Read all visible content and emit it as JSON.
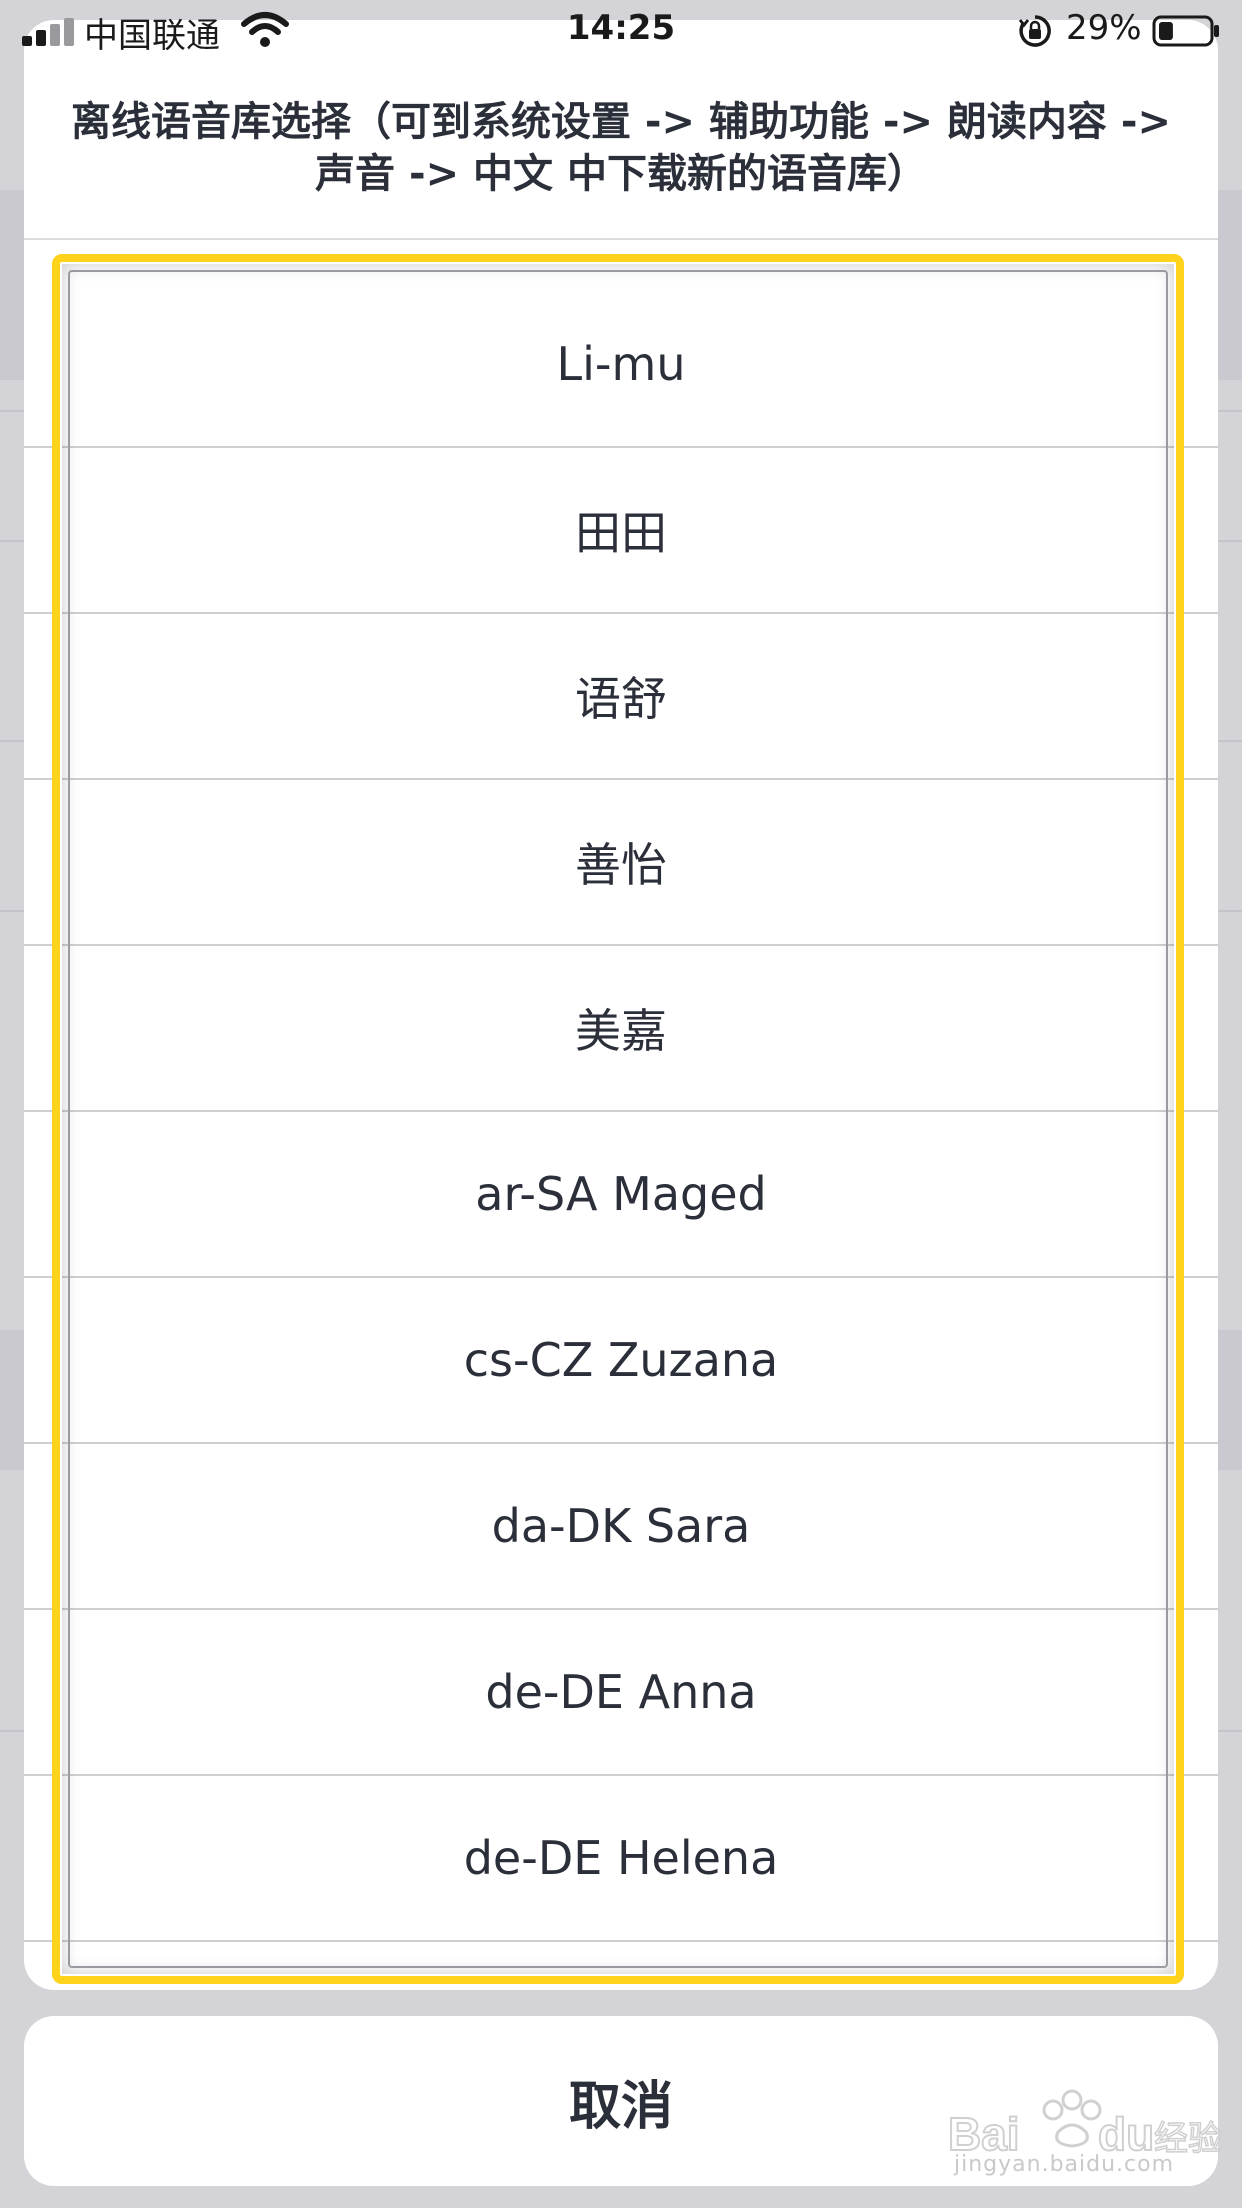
{
  "status_bar": {
    "carrier": "中国联通",
    "time": "14:25",
    "battery_percent": "29%",
    "battery_level": 0.29,
    "icons": [
      "signal-icon",
      "wifi-icon",
      "rotation-lock-icon",
      "battery-icon"
    ]
  },
  "sheet": {
    "title": "离线语音库选择（可到系统设置 -> 辅助功能 -> 朗读内容 -> 声音 -> 中文 中下载新的语音库）",
    "options": [
      {
        "label": "Li-mu"
      },
      {
        "label": "田田"
      },
      {
        "label": "语舒"
      },
      {
        "label": "善怡"
      },
      {
        "label": "美嘉"
      },
      {
        "label": "ar-SA Maged"
      },
      {
        "label": "cs-CZ Zuzana"
      },
      {
        "label": "da-DK Sara"
      },
      {
        "label": "de-DE Anna"
      },
      {
        "label": "de-DE Helena"
      }
    ]
  },
  "cancel_label": "取消",
  "watermark": {
    "logo_text": "Baidu经验",
    "url": "jingyan.baidu.com"
  },
  "colors": {
    "highlight": "#ffd21c",
    "text": "#2b2f3a",
    "backdrop": "#d3d3d8"
  }
}
